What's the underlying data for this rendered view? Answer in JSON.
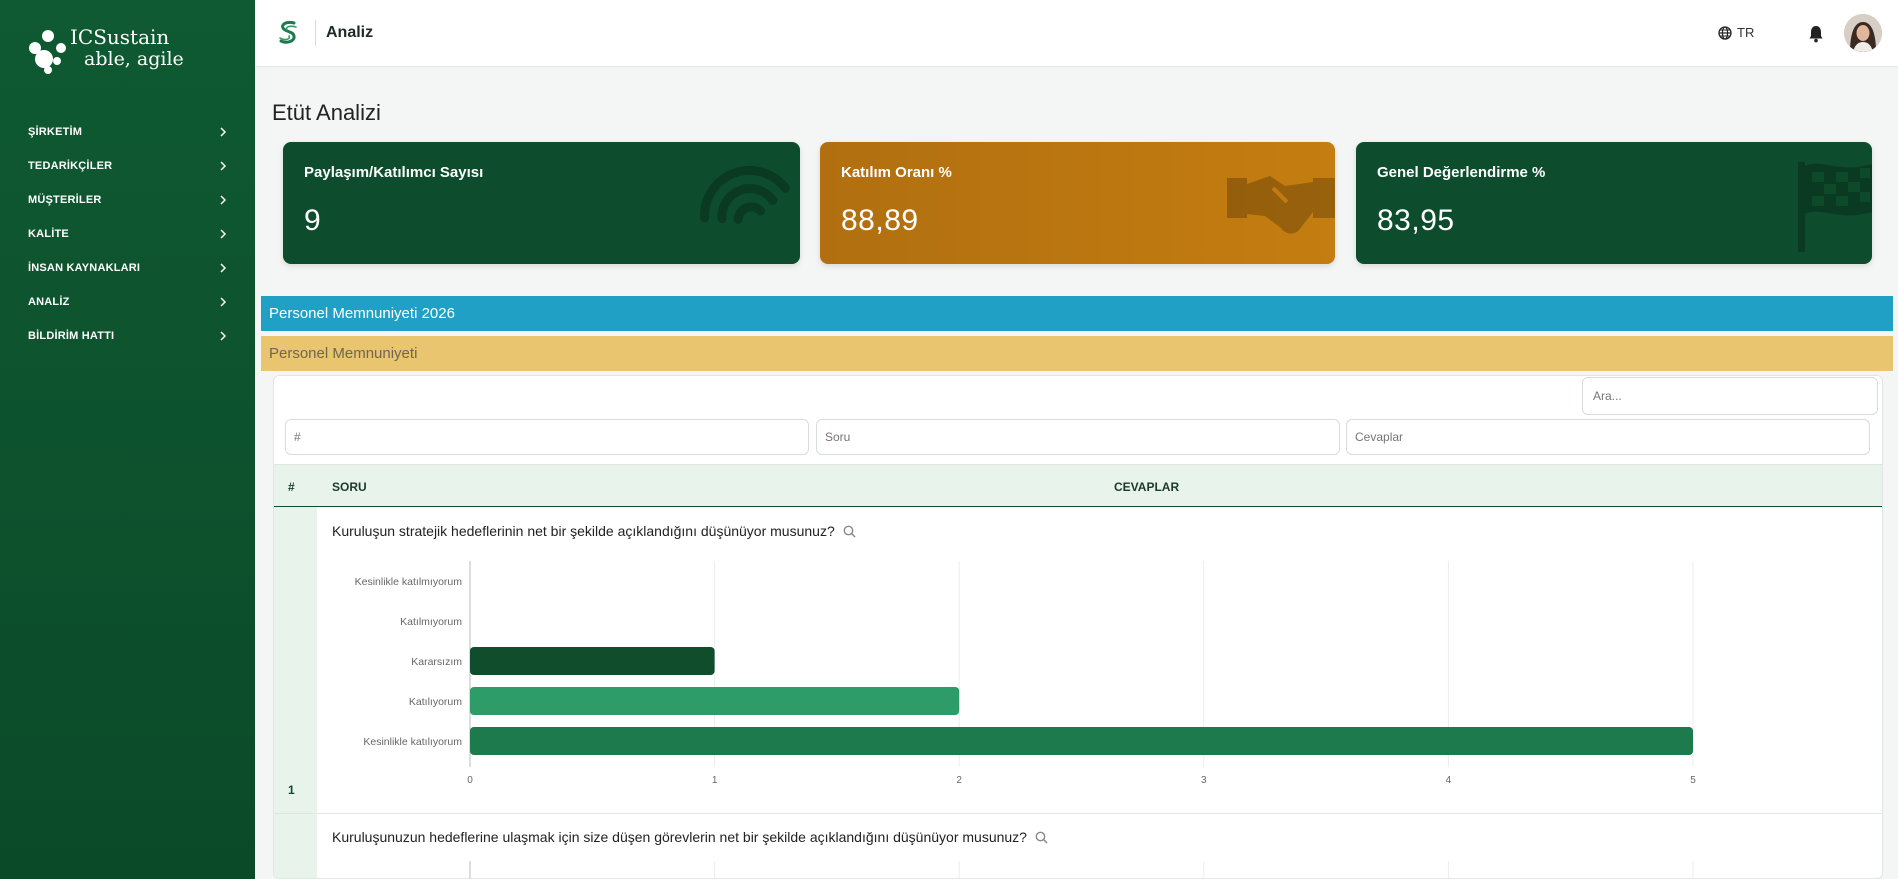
{
  "sidebar": {
    "brand_line1": "ICSustain",
    "brand_line2": "able, agile",
    "items": [
      {
        "label": "ŞİRKETİM"
      },
      {
        "label": "TEDARİKÇİLER"
      },
      {
        "label": "MÜŞTERİLER"
      },
      {
        "label": "KALİTE"
      },
      {
        "label": "İNSAN KAYNAKLARI"
      },
      {
        "label": "ANALİZ"
      },
      {
        "label": "BİLDİRİM HATTI"
      }
    ]
  },
  "topbar": {
    "title": "Analiz",
    "language": "TR"
  },
  "page": {
    "title": "Etüt Analizi"
  },
  "cards": [
    {
      "title": "Paylaşım/Katılımcı Sayısı",
      "value": "9",
      "icon": "wifi-icon",
      "color": "#0d4c2c"
    },
    {
      "title": "Katılım Oranı %",
      "value": "88,89",
      "icon": "handshake-icon",
      "color": "#c47d10"
    },
    {
      "title": "Genel Değerlendirme %",
      "value": "83,95",
      "icon": "flag-icon",
      "color": "#0d4c2c"
    }
  ],
  "bands": {
    "survey": "Personel Memnuniyeti 2026",
    "category": "Personel Memnuniyeti"
  },
  "table": {
    "search_placeholder": "Ara...",
    "filters": {
      "num": "#",
      "soru": "Soru",
      "cevaplar": "Cevaplar"
    },
    "headers": {
      "num": "#",
      "soru": "SORU",
      "cevaplar": "CEVAPLAR"
    },
    "rows": [
      {
        "num": "1",
        "question": "Kuruluşun stratejik hedeflerinin net bir şekilde açıklandığını düşünüyor musunuz?"
      },
      {
        "num": "",
        "question": "Kuruluşunuzun hedeflerine ulaşmak için size düşen görevlerin net bir şekilde açıklandığını düşünüyor musunuz?"
      }
    ]
  },
  "colors": {
    "sidebar": "#0d4c2c",
    "accent_blue": "#20a0c4",
    "accent_yellow": "#e9c56f",
    "bar_dark": "#0d4c2c",
    "bar_mid": "#2e9c68",
    "bar_green": "#1c7a4c"
  },
  "chart_data": {
    "type": "bar",
    "orientation": "horizontal",
    "categories": [
      "Kesinlikle katılmıyorum",
      "Katılmıyorum",
      "Kararsızım",
      "Katılıyorum",
      "Kesinlikle katılıyorum"
    ],
    "values": [
      0,
      0,
      1,
      2,
      5
    ],
    "colors": [
      "#0d4c2c",
      "#0d4c2c",
      "#104d2d",
      "#2e9c68",
      "#1c7a4c"
    ],
    "xlim": [
      0,
      5
    ],
    "xticks": [
      "0",
      "1",
      "2",
      "3",
      "4",
      "5"
    ],
    "grid": true
  }
}
